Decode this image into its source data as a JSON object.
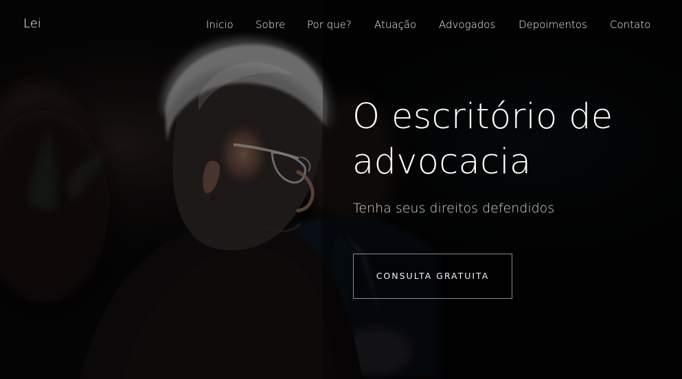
{
  "header": {
    "brand": "Lei",
    "nav": [
      "Inicio",
      "Sobre",
      "Por que?",
      "Atuação",
      "Advogados",
      "Depoimentos",
      "Contato"
    ]
  },
  "hero": {
    "title": "O escritório de advocacia",
    "subtitle": "Tenha seus direitos defendidos",
    "cta_label": "CONSULTA GRATUITA"
  },
  "colors": {
    "overlay": "#000000",
    "text": "#ffffff",
    "secondary_text": "#d7d7d7"
  },
  "image": {
    "subject": "older-woman-with-glasses"
  }
}
